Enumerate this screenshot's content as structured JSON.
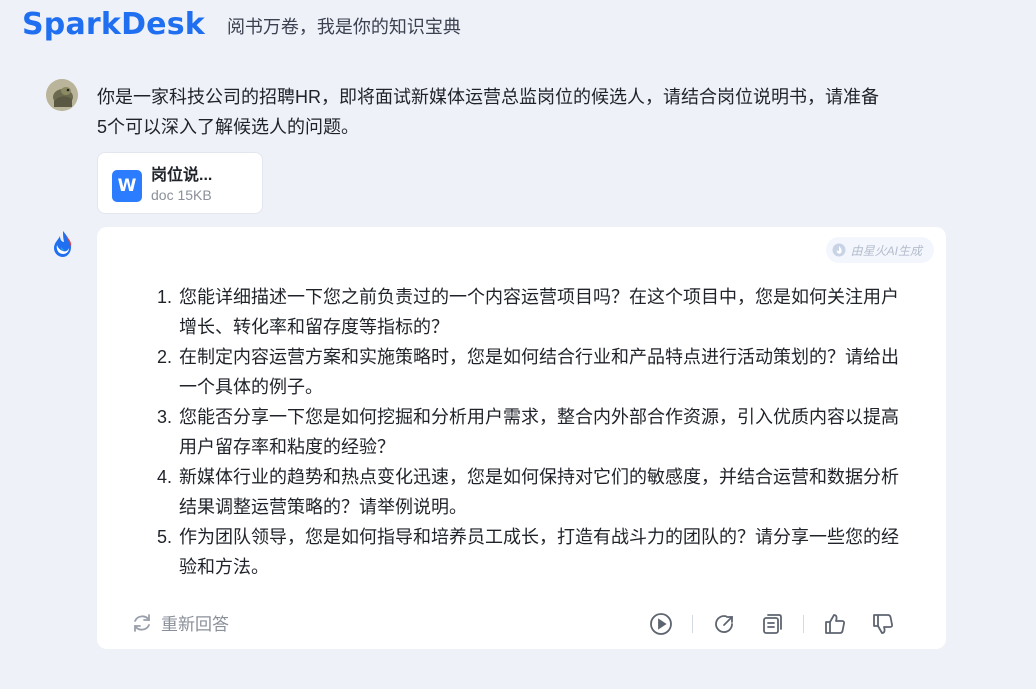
{
  "header": {
    "brand": "SparkDesk",
    "slogan": "阅书万卷，我是你的知识宝典"
  },
  "user_message": {
    "text": "你是一家科技公司的招聘HR，即将面试新媒体运营总监岗位的候选人，请结合岗位说明书，请准备5个可以深入了解候选人的问题。",
    "attachment": {
      "icon_letter": "W",
      "name": "岗位说...",
      "meta": "doc 15KB"
    }
  },
  "answer": {
    "badge": "由星火AI生成",
    "items": [
      {
        "num": "1.",
        "text": "您能详细描述一下您之前负责过的一个内容运营项目吗？在这个项目中，您是如何关注用户增长、转化率和留存度等指标的？"
      },
      {
        "num": "2.",
        "text": "在制定内容运营方案和实施策略时，您是如何结合行业和产品特点进行活动策划的？请给出一个具体的例子。"
      },
      {
        "num": "3.",
        "text": "您能否分享一下您是如何挖掘和分析用户需求，整合内外部合作资源，引入优质内容以提高用户留存率和粘度的经验？"
      },
      {
        "num": "4.",
        "text": "新媒体行业的趋势和热点变化迅速，您是如何保持对它们的敏感度，并结合运营和数据分析结果调整运营策略的？请举例说明。"
      },
      {
        "num": "5.",
        "text": "作为团队领导，您是如何指导和培养员工成长，打造有战斗力的团队的？请分享一些您的经验和方法。"
      }
    ],
    "regenerate_label": "重新回答"
  },
  "icons": {
    "user_avatar": "avatar-photo",
    "bot_avatar": "spark-flame-icon",
    "regenerate": "refresh-icon",
    "play": "play-icon",
    "share": "share-icon",
    "copy": "copy-icon",
    "like": "thumbs-up-icon",
    "dislike": "thumbs-down-icon"
  },
  "colors": {
    "brand": "#1f6ff0",
    "background": "#eef1f8",
    "word": "#2b7cff",
    "icon": "#6b7280"
  }
}
